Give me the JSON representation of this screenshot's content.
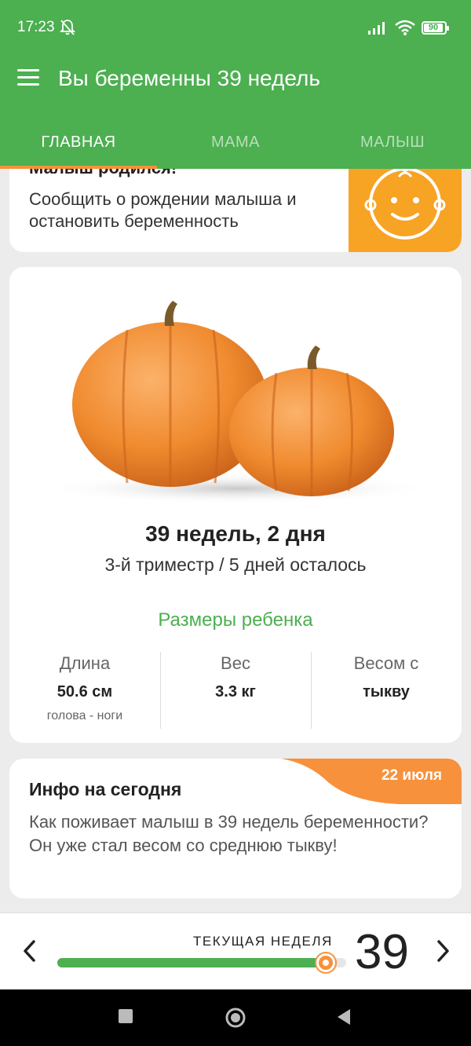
{
  "status_bar": {
    "time": "17:23",
    "battery": "90"
  },
  "header": {
    "title": "Вы беременны 39 недель",
    "tabs": [
      {
        "label": "ГЛАВНАЯ",
        "active": true
      },
      {
        "label": "МАМА",
        "active": false
      },
      {
        "label": "МАЛЫШ",
        "active": false
      }
    ]
  },
  "born_card": {
    "title": "Малыш родился!",
    "description": "Сообщить о рождении малыша и остановить беременность",
    "icon": "baby-face-icon"
  },
  "week_card": {
    "week_text": "39 недель, 2 дня",
    "trimester_text": "3-й триместр / 5 дней осталось",
    "sizes_title": "Размеры ребенка",
    "stats": [
      {
        "label": "Длина",
        "value": "50.6 см",
        "sub": "голова - ноги"
      },
      {
        "label": "Вес",
        "value": "3.3 кг",
        "sub": ""
      },
      {
        "label": "Весом с",
        "value": "тыкву",
        "sub": ""
      }
    ]
  },
  "info_card": {
    "date": "22 июля",
    "title": "Инфо на сегодня",
    "text": "Как поживает малыш в 39 недель беременности? Он уже стал весом со среднюю тыкву!"
  },
  "bottom_bar": {
    "label": "ТЕКУЩАЯ НЕДЕЛЯ",
    "week": "39",
    "progress": 0.93
  },
  "colors": {
    "primary": "#4caf50",
    "accent": "#f7913b",
    "baby_bg": "#f7a324"
  }
}
